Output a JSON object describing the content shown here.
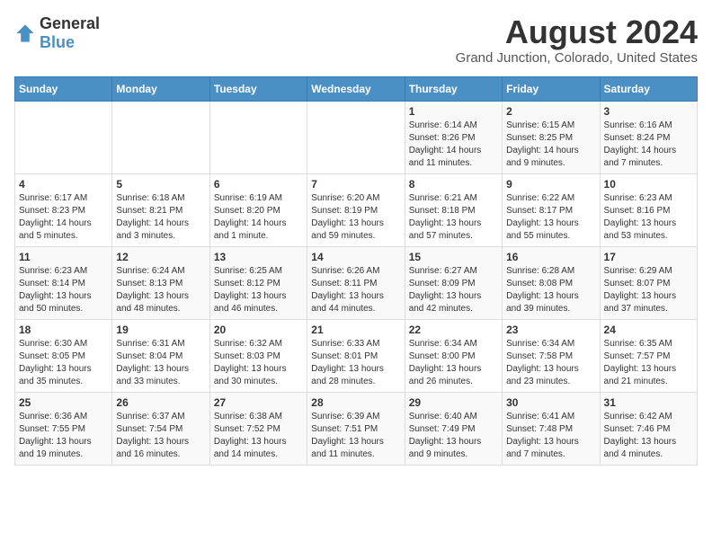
{
  "logo": {
    "general": "General",
    "blue": "Blue"
  },
  "title": "August 2024",
  "subtitle": "Grand Junction, Colorado, United States",
  "days_header": [
    "Sunday",
    "Monday",
    "Tuesday",
    "Wednesday",
    "Thursday",
    "Friday",
    "Saturday"
  ],
  "weeks": [
    [
      {
        "day": "",
        "info": ""
      },
      {
        "day": "",
        "info": ""
      },
      {
        "day": "",
        "info": ""
      },
      {
        "day": "",
        "info": ""
      },
      {
        "day": "1",
        "info": "Sunrise: 6:14 AM\nSunset: 8:26 PM\nDaylight: 14 hours\nand 11 minutes."
      },
      {
        "day": "2",
        "info": "Sunrise: 6:15 AM\nSunset: 8:25 PM\nDaylight: 14 hours\nand 9 minutes."
      },
      {
        "day": "3",
        "info": "Sunrise: 6:16 AM\nSunset: 8:24 PM\nDaylight: 14 hours\nand 7 minutes."
      }
    ],
    [
      {
        "day": "4",
        "info": "Sunrise: 6:17 AM\nSunset: 8:23 PM\nDaylight: 14 hours\nand 5 minutes."
      },
      {
        "day": "5",
        "info": "Sunrise: 6:18 AM\nSunset: 8:21 PM\nDaylight: 14 hours\nand 3 minutes."
      },
      {
        "day": "6",
        "info": "Sunrise: 6:19 AM\nSunset: 8:20 PM\nDaylight: 14 hours\nand 1 minute."
      },
      {
        "day": "7",
        "info": "Sunrise: 6:20 AM\nSunset: 8:19 PM\nDaylight: 13 hours\nand 59 minutes."
      },
      {
        "day": "8",
        "info": "Sunrise: 6:21 AM\nSunset: 8:18 PM\nDaylight: 13 hours\nand 57 minutes."
      },
      {
        "day": "9",
        "info": "Sunrise: 6:22 AM\nSunset: 8:17 PM\nDaylight: 13 hours\nand 55 minutes."
      },
      {
        "day": "10",
        "info": "Sunrise: 6:23 AM\nSunset: 8:16 PM\nDaylight: 13 hours\nand 53 minutes."
      }
    ],
    [
      {
        "day": "11",
        "info": "Sunrise: 6:23 AM\nSunset: 8:14 PM\nDaylight: 13 hours\nand 50 minutes."
      },
      {
        "day": "12",
        "info": "Sunrise: 6:24 AM\nSunset: 8:13 PM\nDaylight: 13 hours\nand 48 minutes."
      },
      {
        "day": "13",
        "info": "Sunrise: 6:25 AM\nSunset: 8:12 PM\nDaylight: 13 hours\nand 46 minutes."
      },
      {
        "day": "14",
        "info": "Sunrise: 6:26 AM\nSunset: 8:11 PM\nDaylight: 13 hours\nand 44 minutes."
      },
      {
        "day": "15",
        "info": "Sunrise: 6:27 AM\nSunset: 8:09 PM\nDaylight: 13 hours\nand 42 minutes."
      },
      {
        "day": "16",
        "info": "Sunrise: 6:28 AM\nSunset: 8:08 PM\nDaylight: 13 hours\nand 39 minutes."
      },
      {
        "day": "17",
        "info": "Sunrise: 6:29 AM\nSunset: 8:07 PM\nDaylight: 13 hours\nand 37 minutes."
      }
    ],
    [
      {
        "day": "18",
        "info": "Sunrise: 6:30 AM\nSunset: 8:05 PM\nDaylight: 13 hours\nand 35 minutes."
      },
      {
        "day": "19",
        "info": "Sunrise: 6:31 AM\nSunset: 8:04 PM\nDaylight: 13 hours\nand 33 minutes."
      },
      {
        "day": "20",
        "info": "Sunrise: 6:32 AM\nSunset: 8:03 PM\nDaylight: 13 hours\nand 30 minutes."
      },
      {
        "day": "21",
        "info": "Sunrise: 6:33 AM\nSunset: 8:01 PM\nDaylight: 13 hours\nand 28 minutes."
      },
      {
        "day": "22",
        "info": "Sunrise: 6:34 AM\nSunset: 8:00 PM\nDaylight: 13 hours\nand 26 minutes."
      },
      {
        "day": "23",
        "info": "Sunrise: 6:34 AM\nSunset: 7:58 PM\nDaylight: 13 hours\nand 23 minutes."
      },
      {
        "day": "24",
        "info": "Sunrise: 6:35 AM\nSunset: 7:57 PM\nDaylight: 13 hours\nand 21 minutes."
      }
    ],
    [
      {
        "day": "25",
        "info": "Sunrise: 6:36 AM\nSunset: 7:55 PM\nDaylight: 13 hours\nand 19 minutes."
      },
      {
        "day": "26",
        "info": "Sunrise: 6:37 AM\nSunset: 7:54 PM\nDaylight: 13 hours\nand 16 minutes."
      },
      {
        "day": "27",
        "info": "Sunrise: 6:38 AM\nSunset: 7:52 PM\nDaylight: 13 hours\nand 14 minutes."
      },
      {
        "day": "28",
        "info": "Sunrise: 6:39 AM\nSunset: 7:51 PM\nDaylight: 13 hours\nand 11 minutes."
      },
      {
        "day": "29",
        "info": "Sunrise: 6:40 AM\nSunset: 7:49 PM\nDaylight: 13 hours\nand 9 minutes."
      },
      {
        "day": "30",
        "info": "Sunrise: 6:41 AM\nSunset: 7:48 PM\nDaylight: 13 hours\nand 7 minutes."
      },
      {
        "day": "31",
        "info": "Sunrise: 6:42 AM\nSunset: 7:46 PM\nDaylight: 13 hours\nand 4 minutes."
      }
    ]
  ]
}
